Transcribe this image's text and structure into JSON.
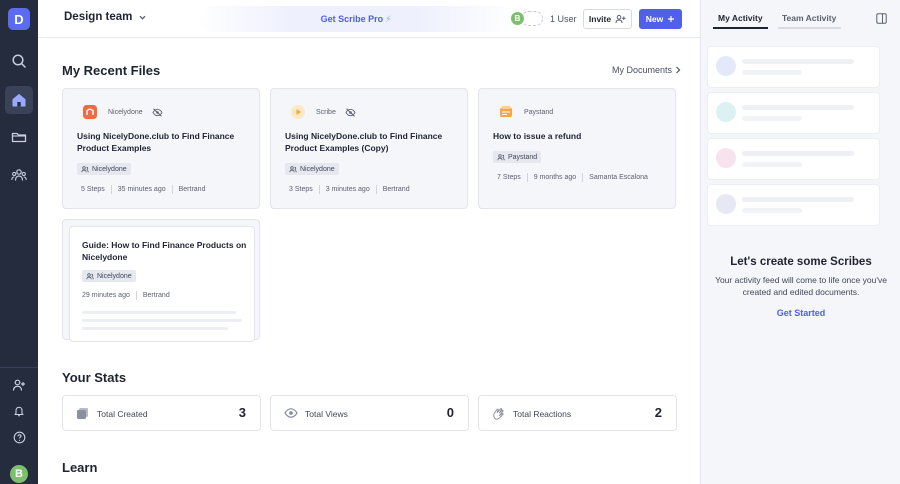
{
  "rail": {
    "logo_letter": "D",
    "avatar_letter": "B"
  },
  "topbar": {
    "team_name": "Design team",
    "promo": "Get Scribe Pro",
    "avatar_letter": "B",
    "user_count": "1 User",
    "invite_label": "Invite",
    "new_label": "New"
  },
  "recent": {
    "heading": "My Recent Files",
    "documents_link": "My Documents",
    "cards": [
      {
        "source": "Nicelydone",
        "title": "Using NicelyDone.club to Find Finance Product Examples",
        "tag": "Nicelydone",
        "steps": "5 Steps",
        "time": "35 minutes ago",
        "author": "Bertrand",
        "icon_color": "#f26a3f"
      },
      {
        "source": "Scribe",
        "title": "Using NicelyDone.club to Find Finance Product Examples (Copy)",
        "tag": "Nicelydone",
        "steps": "3 Steps",
        "time": "3 minutes ago",
        "author": "Bertrand",
        "icon_color": "#f5a742"
      },
      {
        "source": "Paystand",
        "title": "How to issue a refund",
        "tag": "Paystand",
        "steps": "7 Steps",
        "time": "9 months ago",
        "author": "Samanta Escalona",
        "icon_color": "#f5a742"
      }
    ],
    "guide": {
      "title": "Guide: How to Find Finance Products on Nicelydone",
      "tag": "Nicelydone",
      "time": "29 minutes ago",
      "author": "Bertrand"
    }
  },
  "stats": {
    "heading": "Your Stats",
    "items": [
      {
        "label": "Total Created",
        "value": "3"
      },
      {
        "label": "Total Views",
        "value": "0"
      },
      {
        "label": "Total Reactions",
        "value": "2"
      }
    ]
  },
  "learn": {
    "heading": "Learn"
  },
  "panel": {
    "tabs": [
      "My Activity",
      "Team Activity"
    ],
    "active_tab": "My Activity",
    "accent": "#4f5fe0",
    "empty_title": "Let's create some Scribes",
    "empty_desc": "Your activity feed will come to life once you've created and edited documents.",
    "cta": "Get Started"
  }
}
